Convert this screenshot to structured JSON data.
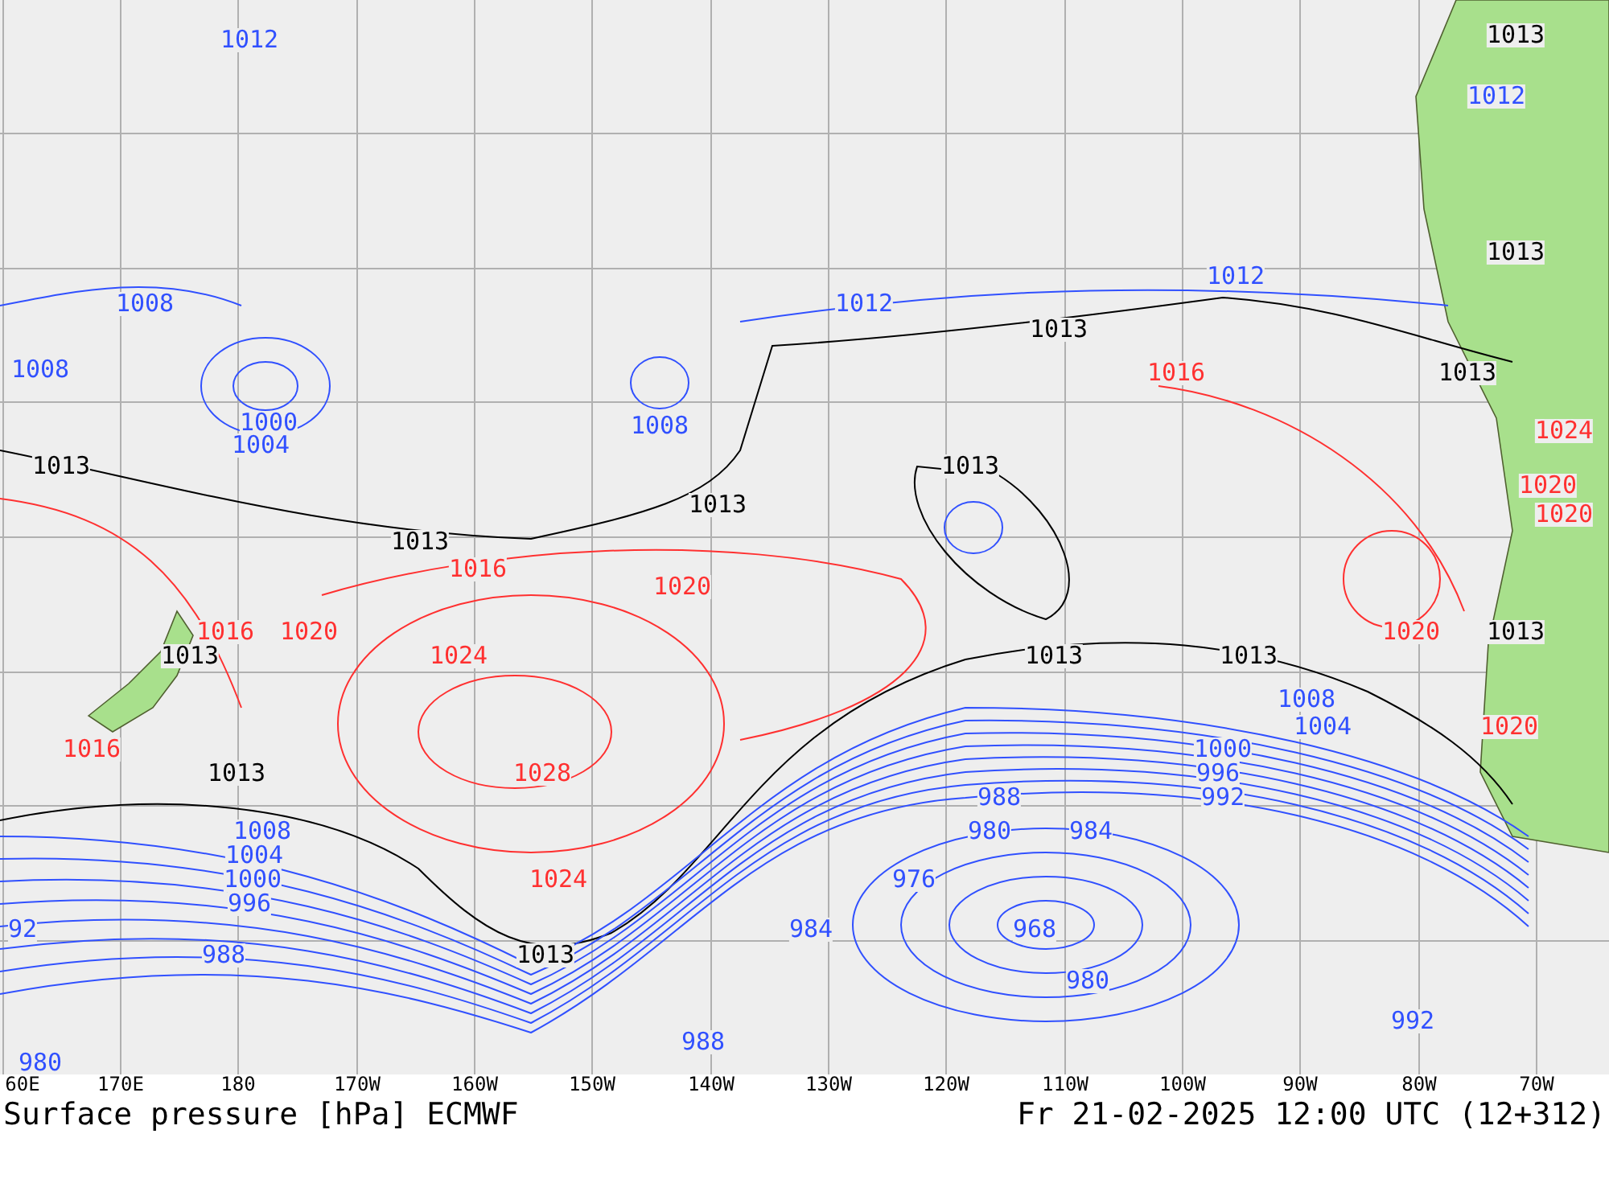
{
  "map": {
    "isobar_labels": [
      {
        "text": "1012",
        "color": "#3050ff"
      },
      {
        "text": "1013",
        "color": "#000000"
      },
      {
        "text": "1012",
        "color": "#3050ff"
      },
      {
        "text": "1013",
        "color": "#000000"
      },
      {
        "text": "1012",
        "color": "#3050ff"
      },
      {
        "text": "1008",
        "color": "#3050ff"
      },
      {
        "text": "1012",
        "color": "#3050ff"
      },
      {
        "text": "1013",
        "color": "#000000"
      },
      {
        "text": "1008",
        "color": "#3050ff"
      },
      {
        "text": "1016",
        "color": "#ff3030"
      },
      {
        "text": "1013",
        "color": "#000000"
      },
      {
        "text": "1000",
        "color": "#3050ff"
      },
      {
        "text": "1008",
        "color": "#3050ff"
      },
      {
        "text": "1024",
        "color": "#ff3030"
      },
      {
        "text": "1004",
        "color": "#3050ff"
      },
      {
        "text": "1013",
        "color": "#000000"
      },
      {
        "text": "1013",
        "color": "#000000"
      },
      {
        "text": "1020",
        "color": "#ff3030"
      },
      {
        "text": "1013",
        "color": "#000000"
      },
      {
        "text": "1020",
        "color": "#ff3030"
      },
      {
        "text": "1013",
        "color": "#000000"
      },
      {
        "text": "1016",
        "color": "#ff3030"
      },
      {
        "text": "1020",
        "color": "#ff3030"
      },
      {
        "text": "1016",
        "color": "#ff3030"
      },
      {
        "text": "1020",
        "color": "#ff3030"
      },
      {
        "text": "1020",
        "color": "#ff3030"
      },
      {
        "text": "1013",
        "color": "#000000"
      },
      {
        "text": "1013",
        "color": "#000000"
      },
      {
        "text": "1024",
        "color": "#ff3030"
      },
      {
        "text": "1013",
        "color": "#000000"
      },
      {
        "text": "1013",
        "color": "#000000"
      },
      {
        "text": "1008",
        "color": "#3050ff"
      },
      {
        "text": "1004",
        "color": "#3050ff"
      },
      {
        "text": "1020",
        "color": "#ff3030"
      },
      {
        "text": "1016",
        "color": "#ff3030"
      },
      {
        "text": "1000",
        "color": "#3050ff"
      },
      {
        "text": "1013",
        "color": "#000000"
      },
      {
        "text": "1028",
        "color": "#ff3030"
      },
      {
        "text": "996",
        "color": "#3050ff"
      },
      {
        "text": "988",
        "color": "#3050ff"
      },
      {
        "text": "992",
        "color": "#3050ff"
      },
      {
        "text": "1008",
        "color": "#3050ff"
      },
      {
        "text": "980",
        "color": "#3050ff"
      },
      {
        "text": "984",
        "color": "#3050ff"
      },
      {
        "text": "1004",
        "color": "#3050ff"
      },
      {
        "text": "1000",
        "color": "#3050ff"
      },
      {
        "text": "1024",
        "color": "#ff3030"
      },
      {
        "text": "976",
        "color": "#3050ff"
      },
      {
        "text": "996",
        "color": "#3050ff"
      },
      {
        "text": "92",
        "color": "#3050ff"
      },
      {
        "text": "984",
        "color": "#3050ff"
      },
      {
        "text": "968",
        "color": "#3050ff"
      },
      {
        "text": "988",
        "color": "#3050ff"
      },
      {
        "text": "1013",
        "color": "#000000"
      },
      {
        "text": "980",
        "color": "#3050ff"
      },
      {
        "text": "992",
        "color": "#3050ff"
      },
      {
        "text": "988",
        "color": "#3050ff"
      },
      {
        "text": "980",
        "color": "#3050ff"
      }
    ]
  },
  "x_ticks": [
    "60E",
    "170E",
    "180",
    "170W",
    "160W",
    "150W",
    "140W",
    "130W",
    "120W",
    "110W",
    "100W",
    "90W",
    "80W",
    "70W"
  ],
  "title": "Surface pressure [hPa] ECMWF",
  "valid_time": "Fr 21-02-2025 12:00 UTC (12+312)"
}
